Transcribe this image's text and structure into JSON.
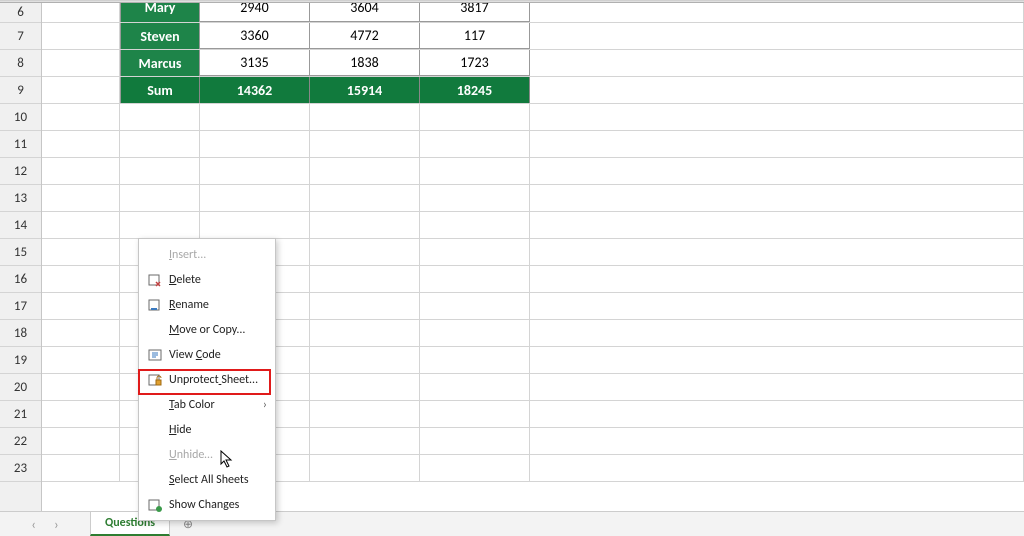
{
  "rows_visible": [
    6,
    7,
    8,
    9,
    10,
    11,
    12,
    13,
    14,
    15,
    16,
    17,
    18,
    19,
    20,
    21,
    22,
    23
  ],
  "table": {
    "rows": [
      {
        "label": "Mary",
        "c": "2940",
        "d": "3604",
        "e": "3817"
      },
      {
        "label": "Steven",
        "c": "3360",
        "d": "4772",
        "e": "117"
      },
      {
        "label": "Marcus",
        "c": "3135",
        "d": "1838",
        "e": "1723"
      }
    ],
    "sum": {
      "label": "Sum",
      "c": "14362",
      "d": "15914",
      "e": "18245"
    }
  },
  "context_menu": [
    {
      "id": "insert",
      "label": "Insert...",
      "underline": 0,
      "icon": "",
      "disabled": true,
      "sub": false
    },
    {
      "id": "delete",
      "label": "Delete",
      "underline": 0,
      "icon": "delete-sheet",
      "disabled": false,
      "sub": false
    },
    {
      "id": "rename",
      "label": "Rename",
      "underline": 0,
      "icon": "rename-sheet",
      "disabled": false,
      "sub": false
    },
    {
      "id": "move",
      "label": "Move or Copy...",
      "underline": 0,
      "icon": "",
      "disabled": false,
      "sub": false
    },
    {
      "id": "viewcode",
      "label": "View Code",
      "underline": 5,
      "icon": "view-code",
      "disabled": false,
      "sub": false
    },
    {
      "id": "unprotect",
      "label": "Unprotect Sheet...",
      "underline": 9,
      "icon": "unprotect-sheet",
      "disabled": false,
      "sub": false
    },
    {
      "id": "tabcolor",
      "label": "Tab Color",
      "underline": 0,
      "icon": "",
      "disabled": false,
      "sub": true
    },
    {
      "id": "hide",
      "label": "Hide",
      "underline": 0,
      "icon": "",
      "disabled": false,
      "sub": false
    },
    {
      "id": "unhide",
      "label": "Unhide…",
      "underline": 0,
      "icon": "",
      "disabled": true,
      "sub": false
    },
    {
      "id": "selectall",
      "label": "Select All Sheets",
      "underline": 0,
      "icon": "",
      "disabled": false,
      "sub": false
    },
    {
      "id": "showchanges",
      "label": "Show Changes",
      "underline": -1,
      "icon": "show-changes",
      "disabled": false,
      "sub": false
    }
  ],
  "tabs": {
    "active": "Questions",
    "nav_prev": "‹",
    "nav_next": "›",
    "new_sheet": "⊕"
  }
}
